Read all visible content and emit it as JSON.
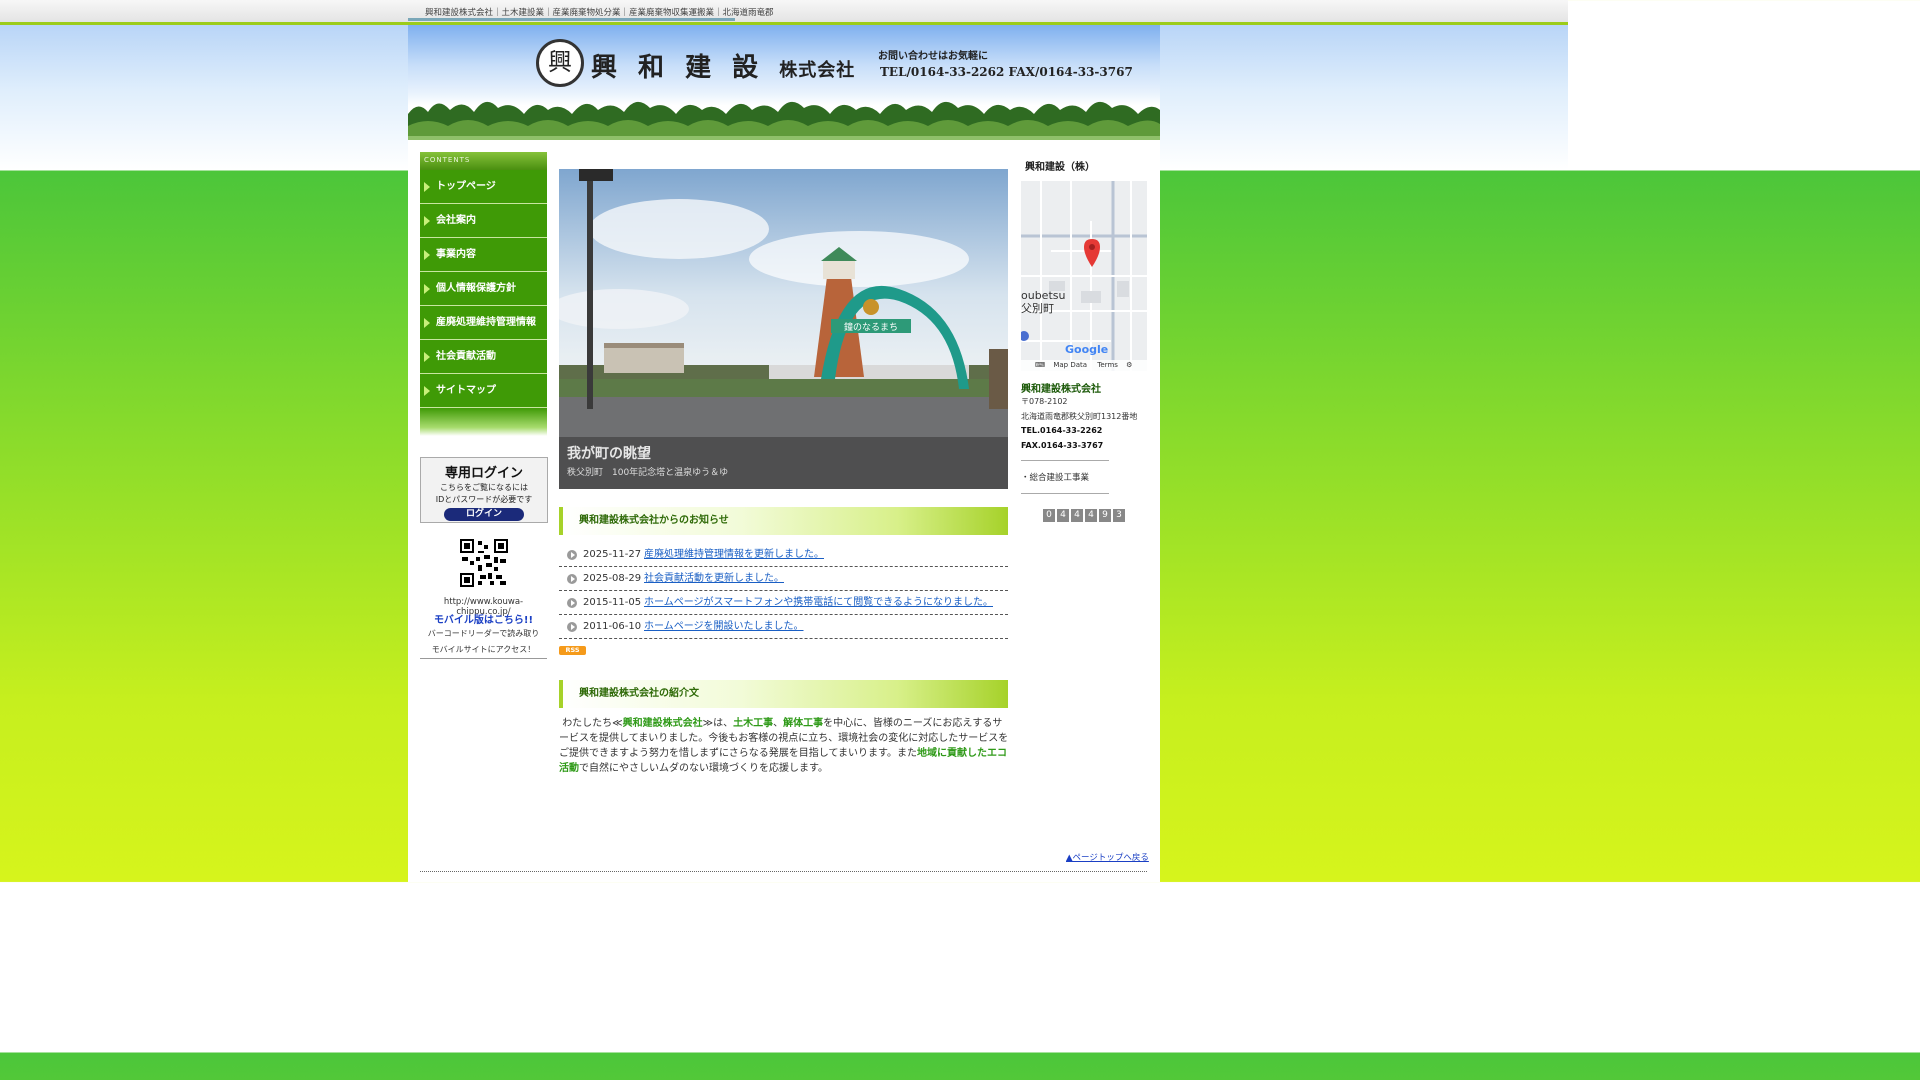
{
  "topbar": {
    "breadcrumb": "興和建設株式会社｜土木建設業｜産業廃棄物処分業｜産業廃棄物収集運搬業｜北海道雨竜郡"
  },
  "header": {
    "logo_char": "興",
    "company_name": "興 和 建 設",
    "company_suffix": "株式会社",
    "contact_note": "お問い合わせはお気軽に",
    "contact_tel": "TEL/0164-33-2262 FAX/0164-33-3767"
  },
  "nav": {
    "head": "CONTENTS",
    "items": [
      {
        "label": "トップページ"
      },
      {
        "label": "会社案内"
      },
      {
        "label": "事業内容"
      },
      {
        "label": "個人情報保護方針"
      },
      {
        "label": "産廃処理維持管理情報"
      },
      {
        "label": "社会貢献活動"
      },
      {
        "label": "サイトマップ"
      }
    ]
  },
  "login": {
    "title": "専用ログイン",
    "note1": "こちらをご覧になるには",
    "note2": "IDとパスワードが必要です",
    "button": "ログイン"
  },
  "mobile": {
    "url": "http://www.kouwa-chippu.co.jp/",
    "link": "モバイル版はこちら!!",
    "note1": "バーコードリーダーで読み取り",
    "note2": "モバイルサイトにアクセス！"
  },
  "hero": {
    "title": "我が町の眺望",
    "subtitle": "秩父別町　100年記念塔と温泉ゆう＆ゆ",
    "arch_sign": "鐘のなるまち"
  },
  "news": {
    "heading": "興和建設株式会社からのお知らせ",
    "items": [
      {
        "date": "2025-11-27",
        "text": "産廃処理維持管理情報を更新しました。"
      },
      {
        "date": "2025-08-29",
        "text": "社会貢献活動を更新しました。"
      },
      {
        "date": "2015-11-05",
        "text": "ホームページがスマートフォンや携帯電話にて閲覧できるようになりました。"
      },
      {
        "date": "2011-06-10",
        "text": "ホームページを開設いたしました。"
      }
    ],
    "rss": "RSS"
  },
  "intro": {
    "heading": "興和建設株式会社の紹介文",
    "p1": "わたしたち≪",
    "company": "興和建設株式会社",
    "p2": "≫は、",
    "service1": "土木工事",
    "sep": "、",
    "service2": "解体工事",
    "p3": "を中心に、皆様のニーズにお応えするサービスを提供してまいりました。今後もお客様の視点に立ち、環境社会の変化に対応したサービスをご提供できますよう努力を惜しまずにさらなる発展を目指してまいります。また",
    "eco": "地域に貢献したエコ活動",
    "p4": "で自然にやさしいムダのない環境づくりを応援します。"
  },
  "footer": {
    "page_top": "▲ページトップへ戻る"
  },
  "sidebar": {
    "title": "興和建設（株）",
    "map_label1": "oubetsu",
    "map_label2": "父別町",
    "map_google": "Google",
    "map_data": "Map Data",
    "map_terms": "Terms",
    "company": "興和建設株式会社",
    "zip": "〒078-2102",
    "address": "北海道雨竜郡秩父別町1312番地",
    "tel": "TEL.0164-33-2262",
    "fax": "FAX.0164-33-3767",
    "service": "・総合建設工事業",
    "counter": [
      "0",
      "4",
      "4",
      "4",
      "9",
      "3"
    ]
  },
  "colors": {
    "nav_green": "#3f9a06",
    "accent_green": "#2f9a18",
    "link_blue": "#1a5fc4"
  }
}
